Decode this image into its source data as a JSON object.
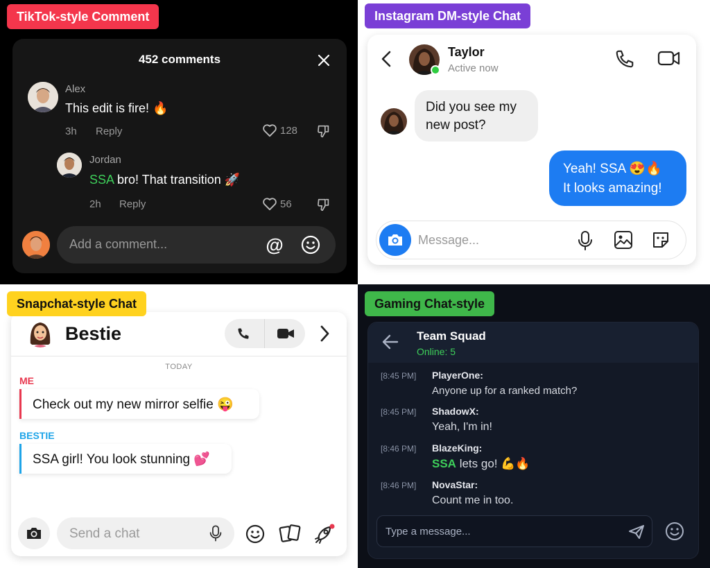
{
  "tiktok": {
    "tag": "TikTok-style Comment",
    "header": "452 comments",
    "comments": [
      {
        "author": "Alex",
        "text": "This edit is fire! 🔥",
        "time": "3h",
        "reply": "Reply",
        "likes": "128"
      },
      {
        "author": "Jordan",
        "highlight": "SSA",
        "text": " bro! That transition 🚀",
        "time": "2h",
        "reply": "Reply",
        "likes": "56"
      }
    ],
    "input_placeholder": "Add a comment...",
    "at_symbol": "@",
    "colors": {
      "tag": "#f4364c",
      "highlight": "#3ecf5a"
    }
  },
  "instagram": {
    "tag": "Instagram DM-style Chat",
    "name": "Taylor",
    "status": "Active now",
    "incoming": [
      "Did you see my",
      "new post?"
    ],
    "outgoing": [
      "Yeah! SSA 😍🔥",
      "It looks amazing!"
    ],
    "input_placeholder": "Message...",
    "colors": {
      "tag": "#7a3fd6",
      "bubble": "#1d7cf2",
      "online": "#2ecc40"
    }
  },
  "snapchat": {
    "tag": "Snapchat-style Chat",
    "name": "Bestie",
    "day": "TODAY",
    "me_label": "ME",
    "me_text": "Check out my new mirror selfie 😜",
    "friend_label": "BESTIE",
    "friend_text": "SSA girl! You look stunning 💕",
    "input_placeholder": "Send a chat",
    "colors": {
      "tag": "#ffd21f",
      "me": "#e8384f",
      "friend": "#1ea4e8"
    }
  },
  "gaming": {
    "tag": "Gaming Chat-style",
    "title": "Team Squad",
    "online": "Online: 5",
    "messages": [
      {
        "time": "[8:45 PM]",
        "user": "PlayerOne:",
        "text": "Anyone up for a ranked match?"
      },
      {
        "time": "[8:45 PM]",
        "user": "ShadowX:",
        "text": "Yeah, I'm in!"
      },
      {
        "time": "[8:46 PM]",
        "user": "BlazeKing:",
        "highlight": "SSA",
        "text": " lets go! 💪🔥"
      },
      {
        "time": "[8:46 PM]",
        "user": "NovaStar:",
        "text": "Count me in too."
      }
    ],
    "input_placeholder": "Type a message...",
    "colors": {
      "tag": "#3fb74a",
      "online": "#3ecf5a"
    }
  }
}
